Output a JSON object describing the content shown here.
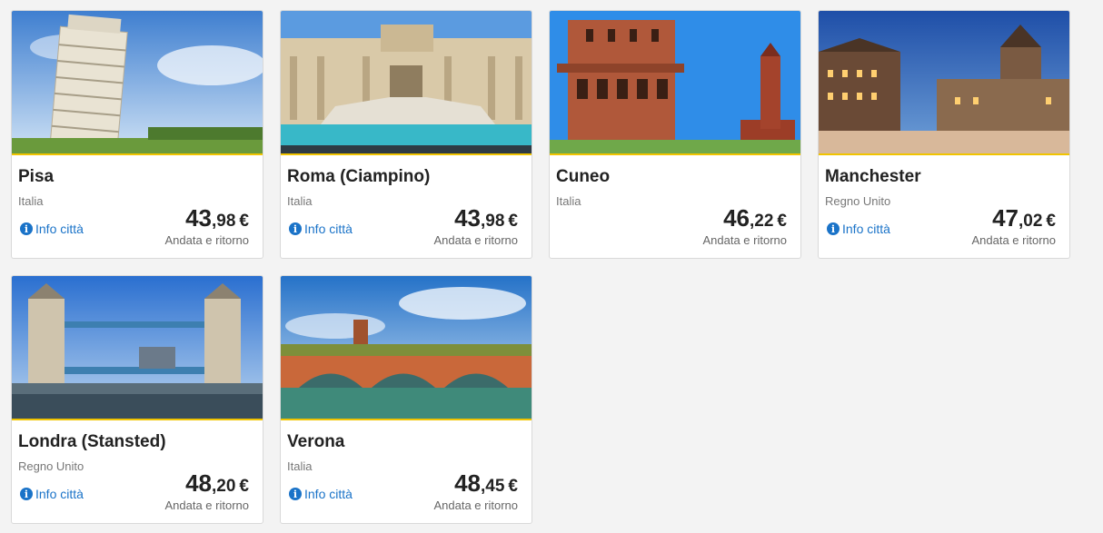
{
  "accent_color": "#f1c400",
  "link_color": "#1a73c8",
  "destinations": [
    {
      "city": "Pisa",
      "country": "Italia",
      "info": "Info città",
      "price_int": "43",
      "price_dec": ",98",
      "currency": "€",
      "trip": "Andata e ritorno",
      "image": "leaning-tower-of-pisa"
    },
    {
      "city": "Roma (Ciampino)",
      "country": "Italia",
      "info": "Info città",
      "price_int": "43",
      "price_dec": ",98",
      "currency": "€",
      "trip": "Andata e ritorno",
      "image": "trevi-fountain"
    },
    {
      "city": "Cuneo",
      "country": "Italia",
      "info": "",
      "price_int": "46",
      "price_dec": ",22",
      "currency": "€",
      "trip": "Andata e ritorno",
      "image": "cuneo-tower"
    },
    {
      "city": "Manchester",
      "country": "Regno Unito",
      "info": "Info città",
      "price_int": "47",
      "price_dec": ",02",
      "currency": "€",
      "trip": "Andata e ritorno",
      "image": "manchester-town-hall"
    },
    {
      "city": "Londra (Stansted)",
      "country": "Regno Unito",
      "info": "Info città",
      "price_int": "48",
      "price_dec": ",20",
      "currency": "€",
      "trip": "Andata e ritorno",
      "image": "tower-bridge"
    },
    {
      "city": "Verona",
      "country": "Italia",
      "info": "Info città",
      "price_int": "48",
      "price_dec": ",45",
      "currency": "€",
      "trip": "Andata e ritorno",
      "image": "ponte-pietra-verona"
    }
  ]
}
